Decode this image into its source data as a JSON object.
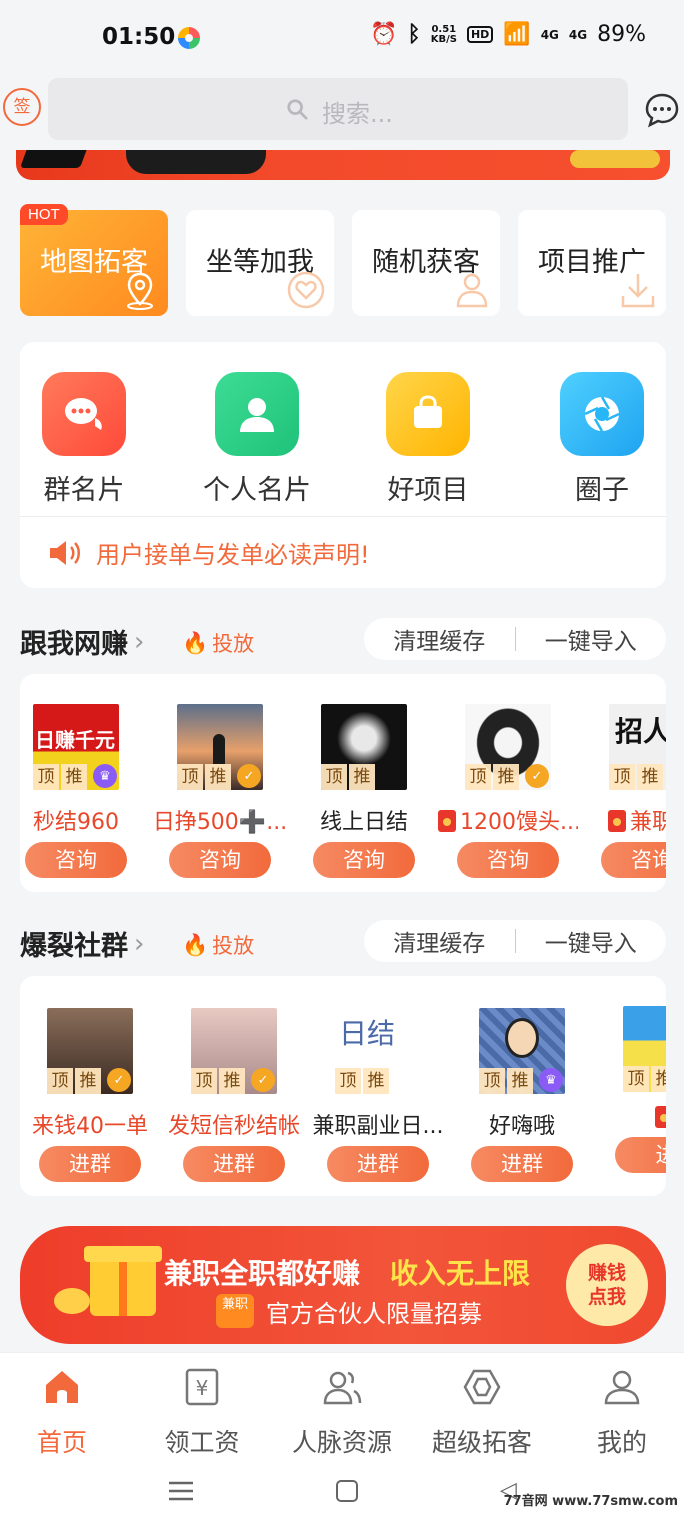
{
  "status_bar": {
    "time": "01:50",
    "net_speed_value": "0.51",
    "net_speed_unit": "KB/S",
    "hd_label": "HD",
    "signal_label": "4G",
    "battery": "89%"
  },
  "header": {
    "sign_label": "签",
    "search_placeholder": "搜索..."
  },
  "quick_tiles": [
    {
      "label": "地图拓客",
      "badge": "HOT"
    },
    {
      "label": "坐等加我"
    },
    {
      "label": "随机获客"
    },
    {
      "label": "项目推广"
    }
  ],
  "features": [
    {
      "label": "群名片",
      "icon": "chat-bubbles-icon",
      "color": "#ff5a4a"
    },
    {
      "label": "个人名片",
      "icon": "person-icon",
      "color": "#2fcf86"
    },
    {
      "label": "好项目",
      "icon": "shopping-bag-icon",
      "color": "#ffc21f"
    },
    {
      "label": "圈子",
      "icon": "aperture-icon",
      "color": "#27b6f6"
    }
  ],
  "notice": {
    "text": "用户接单与发单必读声明!"
  },
  "section1": {
    "title": "跟我网赚",
    "chevron": "›",
    "tou_label": "投放",
    "clear_cache": "清理缓存",
    "import_all": "一键导入",
    "thumb_text": "日赚千元",
    "thumb_text2": "招人",
    "tag_ding": "顶",
    "tag_tui": "推",
    "items": [
      {
        "name": "秒结960",
        "action": "咨询"
      },
      {
        "name": "日挣500➕...",
        "action": "咨询"
      },
      {
        "name": "线上日结",
        "action": "咨询"
      },
      {
        "name": "1200馒头...",
        "action": "咨询"
      },
      {
        "name": "兼职项",
        "action": "咨询"
      }
    ]
  },
  "section2": {
    "title": "爆裂社群",
    "chevron": "›",
    "tou_label": "投放",
    "clear_cache": "清理缓存",
    "import_all": "一键导入",
    "thumb_text": "日结",
    "tag_ding": "顶",
    "tag_tui": "推",
    "items": [
      {
        "name": "来钱40一单",
        "action": "进群"
      },
      {
        "name": "发短信秒结帐",
        "action": "进群"
      },
      {
        "name": "兼职副业日...",
        "action": "进群"
      },
      {
        "name": "好嗨哦",
        "action": "进群"
      },
      {
        "name": "",
        "action": "进"
      }
    ]
  },
  "promo": {
    "headline": "兼职全职都好赚",
    "highlight": "收入无上限",
    "logo_text": "兼职",
    "subline": "官方合伙人限量招募",
    "cta": "赚钱点我"
  },
  "tabs": [
    {
      "label": "首页",
      "icon": "home-icon"
    },
    {
      "label": "领工资",
      "icon": "wallet-yen-icon"
    },
    {
      "label": "人脉资源",
      "icon": "people-icon"
    },
    {
      "label": "超级拓客",
      "icon": "hexagon-icon"
    },
    {
      "label": "我的",
      "icon": "profile-icon"
    }
  ],
  "watermark": "77音网 www.77smw.com",
  "colors": {
    "accent": "#f26a3c",
    "background": "#f4f5f7"
  }
}
